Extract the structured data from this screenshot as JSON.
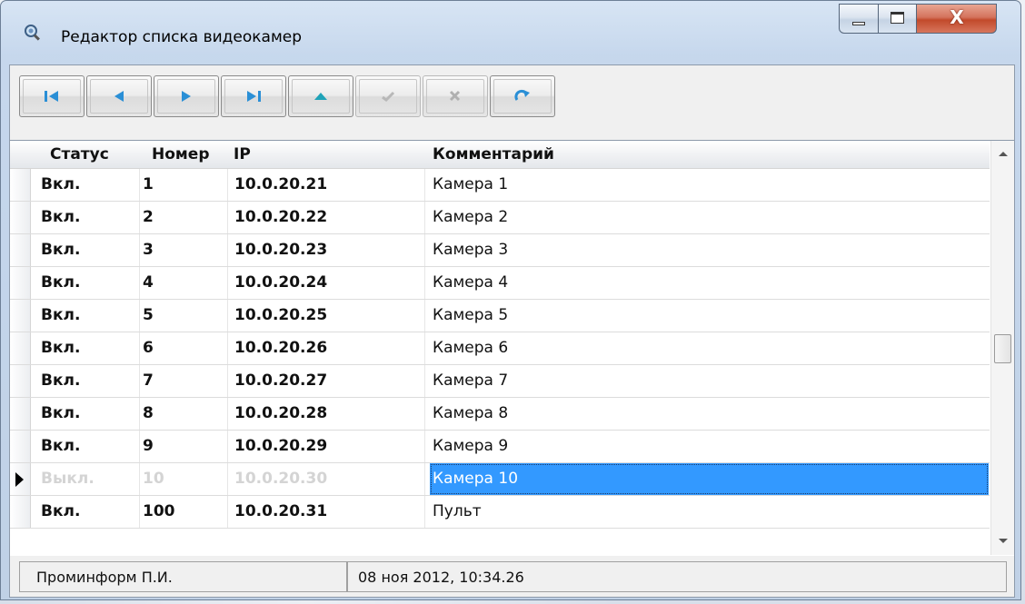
{
  "window": {
    "title": "Редактор списка видеокамер",
    "close_symbol": "X"
  },
  "toolbar": {
    "buttons": [
      {
        "icon": "first-record-icon",
        "enabled": true
      },
      {
        "icon": "prior-record-icon",
        "enabled": true
      },
      {
        "icon": "next-record-icon",
        "enabled": true
      },
      {
        "icon": "last-record-icon",
        "enabled": true
      },
      {
        "icon": "insert-record-icon",
        "enabled": true
      },
      {
        "icon": "post-checkmark-icon",
        "enabled": false
      },
      {
        "icon": "cancel-x-icon",
        "enabled": false
      },
      {
        "icon": "refresh-icon",
        "enabled": true
      }
    ]
  },
  "grid": {
    "columns": [
      "Статус",
      "Номер",
      "IP",
      "Комментарий"
    ],
    "rows": [
      {
        "status": "Вкл.",
        "number": "1",
        "ip": "10.0.20.21",
        "comment": "Камера 1"
      },
      {
        "status": "Вкл.",
        "number": "2",
        "ip": "10.0.20.22",
        "comment": "Камера 2"
      },
      {
        "status": "Вкл.",
        "number": "3",
        "ip": "10.0.20.23",
        "comment": "Камера 3"
      },
      {
        "status": "Вкл.",
        "number": "4",
        "ip": "10.0.20.24",
        "comment": "Камера 4"
      },
      {
        "status": "Вкл.",
        "number": "5",
        "ip": "10.0.20.25",
        "comment": "Камера 5"
      },
      {
        "status": "Вкл.",
        "number": "6",
        "ip": "10.0.20.26",
        "comment": "Камера 6"
      },
      {
        "status": "Вкл.",
        "number": "7",
        "ip": "10.0.20.27",
        "comment": "Камера 7"
      },
      {
        "status": "Вкл.",
        "number": "8",
        "ip": "10.0.20.28",
        "comment": "Камера 8"
      },
      {
        "status": "Вкл.",
        "number": "9",
        "ip": "10.0.20.29",
        "comment": "Камера 9"
      },
      {
        "status": "Выкл.",
        "number": "10",
        "ip": "10.0.20.30",
        "comment": "Камера 10"
      },
      {
        "status": "Вкл.",
        "number": "100",
        "ip": "10.0.20.31",
        "comment": "Пульт"
      }
    ],
    "selected_row": 9,
    "disabled_rows": [
      9
    ]
  },
  "statusbar": {
    "user": "Проминформ П.И.",
    "datetime": "08 ноя 2012, 10:34.26"
  },
  "colors": {
    "selection": "#3399ff",
    "toolbar_arrow": "#2a8fd6",
    "insert_arrow": "#1fa3b8",
    "close_button": "#c24a2b"
  }
}
